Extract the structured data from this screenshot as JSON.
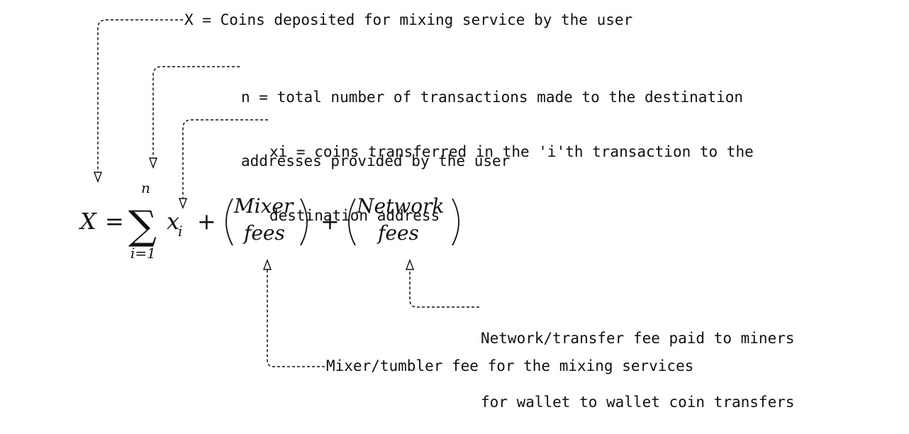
{
  "annotations": {
    "x_def": "X = Coins deposited for mixing service by the user",
    "n_def": {
      "line1": "n = total number of transactions made to the destination",
      "line2": "addresses provided by the user"
    },
    "xi_def": {
      "line1": "xi = coins transferred in the 'i'th transaction to the",
      "line2": "destination address"
    },
    "network_fee": {
      "line1": "Network/transfer fee paid to miners",
      "line2": "for wallet to wallet coin transfers"
    },
    "mixer_fee": "Mixer/tumbler fee for the mixing services"
  },
  "formula": {
    "lhs": "X",
    "equals": "=",
    "sum_symbol": "∑",
    "upper_limit": "n",
    "lower_limit": "i=1",
    "term_base": "x",
    "term_subscript": "i",
    "plus": "+",
    "mixer_fees": {
      "top": "Mixer",
      "bottom": "fees"
    },
    "network_fees": {
      "top": "Network",
      "bottom": "fees"
    }
  }
}
